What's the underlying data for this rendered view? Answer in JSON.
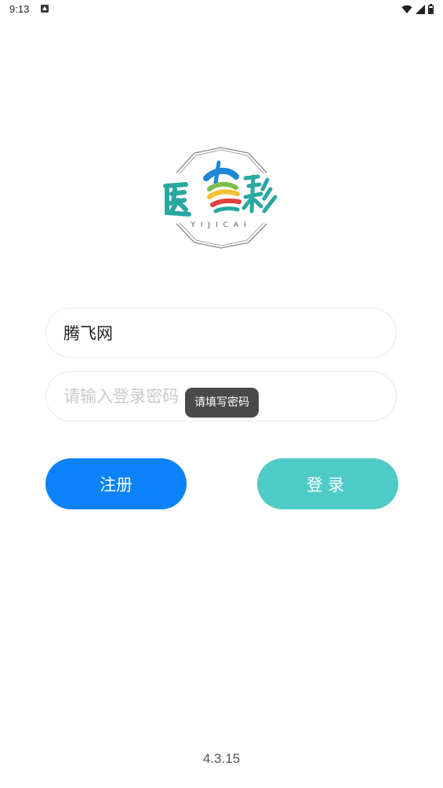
{
  "status_bar": {
    "time": "9:13",
    "icons": [
      "notification-icon",
      "wifi-icon",
      "signal-icon",
      "battery-icon"
    ]
  },
  "logo": {
    "brand_text": "YIJICAI",
    "calligraphy": "医彩",
    "colors": {
      "teal": "#2aa7a2",
      "blue": "#1e88d6",
      "red": "#e0413d",
      "yellow": "#f2c12e",
      "green": "#7cc04a",
      "frame": "#8a8a8a"
    }
  },
  "form": {
    "username_value": "腾飞网",
    "password_value": "",
    "password_placeholder": "请输入登录密码"
  },
  "toast": {
    "message": "请填写密码"
  },
  "buttons": {
    "register_label": "注册",
    "login_label": "登录",
    "register_color": "#0a82fa",
    "login_color": "#4ecbc6"
  },
  "footer": {
    "version": "4.3.15"
  }
}
